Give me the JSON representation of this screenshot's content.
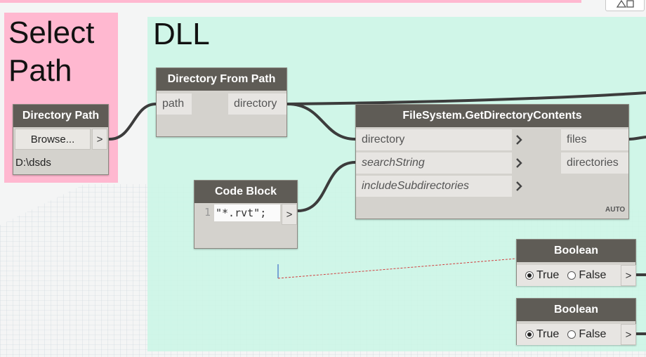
{
  "groups": [
    {
      "title": "Select\nPath",
      "color": "#ffb8d0"
    },
    {
      "title": "DLL",
      "color": "#d7f7ec"
    }
  ],
  "nodes": {
    "directory_path": {
      "title": "Directory Path",
      "browse_label": "Browse...",
      "output_label": ">",
      "value": "D:\\dsds"
    },
    "directory_from_path": {
      "title": "Directory From Path",
      "input": "path",
      "output": "directory"
    },
    "get_directory_contents": {
      "title": "FileSystem.GetDirectoryContents",
      "inputs": [
        "directory",
        "searchString",
        "includeSubdirectories"
      ],
      "outputs": [
        "files",
        "directories"
      ],
      "lacing": "AUTO"
    },
    "code_block": {
      "title": "Code Block",
      "line_number": "1",
      "code": "\"*.rvt\";",
      "output_label": ">"
    },
    "boolean_1": {
      "title": "Boolean",
      "options": [
        "True",
        "False"
      ],
      "selected": "True",
      "output_label": ">"
    },
    "boolean_2": {
      "title": "Boolean",
      "options": [
        "True",
        "False"
      ],
      "selected": "True",
      "output_label": ">"
    }
  },
  "colors": {
    "node_header": "#5f5c56",
    "node_body": "#d4d2cd",
    "wire": "#3c3c3c",
    "group_pink": "#ffb8d0",
    "group_green": "#d7f7ec"
  }
}
